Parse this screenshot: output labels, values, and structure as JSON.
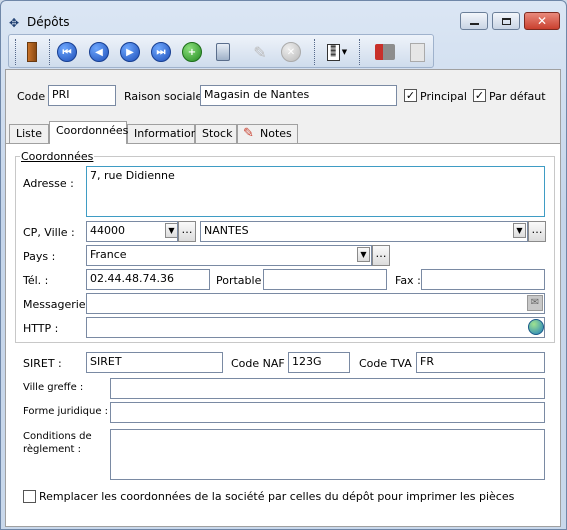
{
  "window": {
    "title": "Dépôts"
  },
  "toolbar": {
    "buttons": [
      "exit-icon",
      "first-record-icon",
      "previous-record-icon",
      "next-record-icon",
      "last-record-icon",
      "add-icon",
      "delete-icon",
      "edit-icon",
      "cancel-icon",
      "report-icon",
      "stock-icon",
      "document-icon"
    ]
  },
  "header": {
    "code_label": "Code :",
    "code_value": "PRI",
    "raison_label": "Raison sociale :",
    "raison_value": "Magasin de Nantes",
    "principal_label": "Principal",
    "principal_checked": true,
    "defaut_label": "Par défaut",
    "defaut_checked": true
  },
  "tabs": [
    {
      "label": "Liste"
    },
    {
      "label": "Coordonnées",
      "active": true
    },
    {
      "label": "Informations"
    },
    {
      "label": "Stock"
    },
    {
      "label": "Notes"
    }
  ],
  "coordonnees": {
    "group_label": "Coordonnées",
    "adresse_label": "Adresse :",
    "adresse_value": "7, rue Didienne",
    "cp_label": "CP, Ville :",
    "cp_value": "44000",
    "ville_value": "NANTES",
    "pays_label": "Pays :",
    "pays_value": "France",
    "tel_label": "Tél. :",
    "tel_value": "02.44.48.74.36",
    "portable_label": "Portable :",
    "portable_value": "",
    "fax_label": "Fax :",
    "fax_value": "",
    "messagerie_label": "Messagerie :",
    "messagerie_value": "",
    "http_label": "HTTP :",
    "http_value": ""
  },
  "legal": {
    "siret_label": "SIRET :",
    "siret_value": "SIRET",
    "naf_label": "Code NAF :",
    "naf_value": "123G",
    "tva_label": "Code TVA :",
    "tva_value": "FR",
    "ville_greffe_label": "Ville greffe :",
    "ville_greffe_value": "",
    "forme_label": "Forme juridique :",
    "forme_value": "",
    "conditions_label": "Conditions de règlement :",
    "conditions_value": ""
  },
  "footer": {
    "replace_label": "Remplacer les coordonnées de la société par celles du dépôt pour imprimer les pièces",
    "replace_checked": false
  },
  "colors": {
    "accent": "#1f4fb8",
    "close": "#c9402f"
  }
}
